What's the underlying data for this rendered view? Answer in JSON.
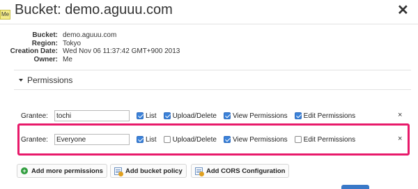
{
  "me_tab": "Me",
  "dialog": {
    "title": "Bucket: demo.aguuu.com",
    "close_glyph": "✕"
  },
  "info": [
    {
      "key": "Bucket:",
      "value": "demo.aguuu.com"
    },
    {
      "key": "Region:",
      "value": "Tokyo"
    },
    {
      "key": "Creation Date:",
      "value": "Wed Nov 06 11:37:42 GMT+900 2013"
    },
    {
      "key": "Owner:",
      "value": "Me"
    }
  ],
  "permissions": {
    "heading": "Permissions",
    "grantee_label": "Grantee:",
    "remove_glyph": "×",
    "checkbox_labels": {
      "list": "List",
      "upload": "Upload/Delete",
      "view": "View Permissions",
      "edit": "Edit Permissions"
    },
    "rows": [
      {
        "grantee": "tochi",
        "list": true,
        "upload": true,
        "view": true,
        "edit": true
      },
      {
        "grantee": "Everyone",
        "list": true,
        "upload": false,
        "view": true,
        "edit": false
      }
    ]
  },
  "buttons": {
    "add_permissions": "Add more permissions",
    "add_bucket_policy": "Add bucket policy",
    "add_cors": "Add CORS Configuration"
  },
  "colors": {
    "highlight": "#e8196a",
    "checkbox_checked": "#3b82d9",
    "add_icon": "#2f9d3d"
  }
}
